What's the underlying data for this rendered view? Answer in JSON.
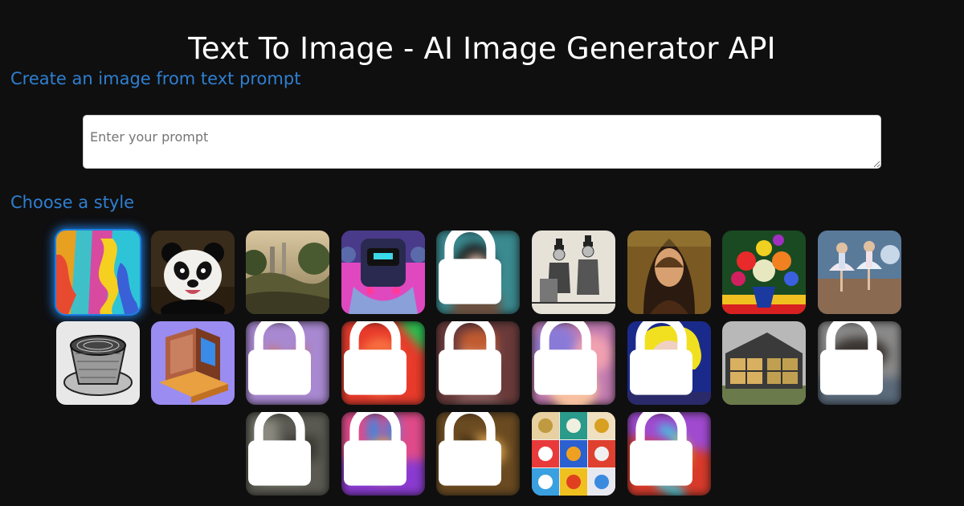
{
  "page": {
    "title": "Text To Image - AI Image Generator API"
  },
  "prompt_section": {
    "heading": "Create an image from text prompt",
    "input_placeholder": "Enter your prompt",
    "input_value": ""
  },
  "style_section": {
    "heading": "Choose a style",
    "selected_index": 0,
    "lock_icon": "lock-icon",
    "styles": [
      {
        "art": "abstract-paint",
        "locked": false,
        "selected": true
      },
      {
        "art": "panda",
        "locked": false,
        "selected": false
      },
      {
        "art": "landscape-painting",
        "locked": false,
        "selected": false
      },
      {
        "art": "robot-neon",
        "locked": false,
        "selected": false
      },
      {
        "art": "anime-portrait",
        "locked": true,
        "selected": false
      },
      {
        "art": "vintage-sketch",
        "locked": false,
        "selected": false
      },
      {
        "art": "renaissance-portrait",
        "locked": false,
        "selected": false
      },
      {
        "art": "flower-vase",
        "locked": false,
        "selected": false
      },
      {
        "art": "impressionist-ballet",
        "locked": false,
        "selected": false
      },
      {
        "art": "engraving-cup",
        "locked": false,
        "selected": false
      },
      {
        "art": "isometric-laptop",
        "locked": false,
        "selected": false
      },
      {
        "art": "low-poly-fox",
        "locked": true,
        "selected": false
      },
      {
        "art": "neon-face",
        "locked": true,
        "selected": false
      },
      {
        "art": "fantasy-portrait",
        "locked": true,
        "selected": false
      },
      {
        "art": "pastel-clouds",
        "locked": true,
        "selected": false
      },
      {
        "art": "pop-art-portrait",
        "locked": true,
        "selected": false
      },
      {
        "art": "modern-house",
        "locked": false,
        "selected": false
      },
      {
        "art": "dark-sculpture",
        "locked": true,
        "selected": false
      },
      {
        "art": "gray-collage",
        "locked": true,
        "selected": false
      },
      {
        "art": "gradient-rabbit",
        "locked": true,
        "selected": false
      },
      {
        "art": "old-oil-painting",
        "locked": true,
        "selected": false
      },
      {
        "art": "icon-grid",
        "locked": false,
        "selected": false
      },
      {
        "art": "neon-dragon",
        "locked": true,
        "selected": false
      }
    ]
  },
  "colors": {
    "background": "#0f0f10",
    "heading_blue": "#2f7fd0",
    "selected_glow": "#1c7fe0"
  }
}
